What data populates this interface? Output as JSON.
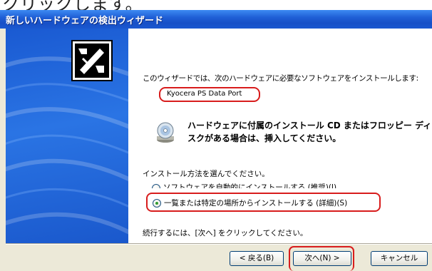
{
  "window": {
    "title": "新しいハードウェアの検出ウィザード",
    "above_text": "クリックします。"
  },
  "content": {
    "intro": "このウィザードでは、次のハードウェアに必要なソフトウェアをインストールします:",
    "device_name": "Kyocera PS Data Port",
    "cd_line1": "ハードウェアに付属のインストール CD またはフロッピー ディ",
    "cd_line2": "スクがある場合は、挿入してください。",
    "choose_prompt": "インストール方法を選んでください。",
    "options": [
      {
        "label": "ソフトウェアを自動的にインストールする (推奨)(I)",
        "selected": false
      },
      {
        "label": "一覧または特定の場所からインストールする (詳細)(S)",
        "selected": true
      }
    ],
    "continue_text": "続行するには、[次へ] をクリックしてください。"
  },
  "buttons": {
    "back": "< 戻る(B)",
    "next": "次へ(N) >",
    "cancel": "キャンセル"
  },
  "icons": {
    "wizard": "hardware-wizard-icon",
    "cd": "cd-drive-icon"
  },
  "colors": {
    "title_bar": "#1f5fd6",
    "sidebar": "#2a74e4",
    "highlight": "#d81c1c",
    "dialog_face": "#ece9d8"
  }
}
